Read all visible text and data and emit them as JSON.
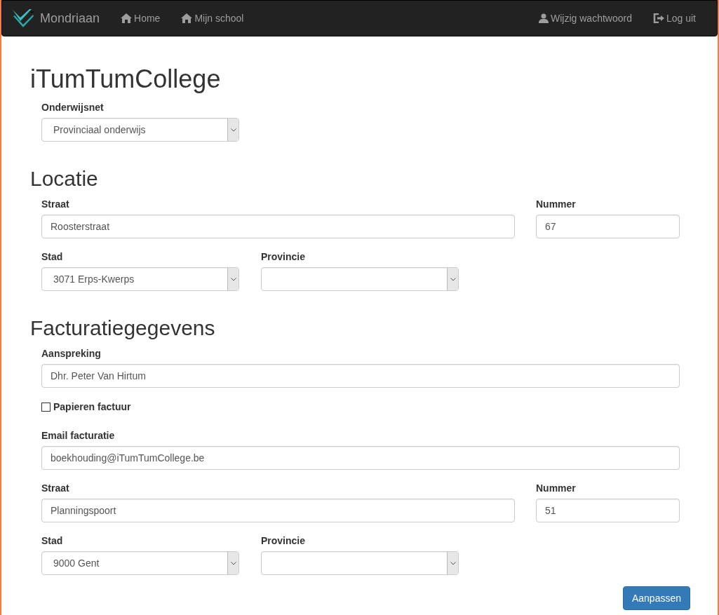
{
  "navbar": {
    "brand": "Mondriaan",
    "left_links": [
      {
        "kind": "home",
        "label": "Home"
      },
      {
        "kind": "home",
        "label": "Mijn school"
      }
    ],
    "right_links": [
      {
        "kind": "account",
        "label": "Wijzig wachtwoord"
      },
      {
        "kind": "exit",
        "label": "Log uit"
      }
    ]
  },
  "title": "iTumTumCollege",
  "onderwijsnet": {
    "label": "Onderwijsnet",
    "value": "Provinciaal onderwijs"
  },
  "locatie": {
    "heading": "Locatie",
    "straat": {
      "label": "Straat",
      "value": "Roosterstraat"
    },
    "nummer": {
      "label": "Nummer",
      "value": "67"
    },
    "stad": {
      "label": "Stad",
      "value": "3071 Erps-Kwerps"
    },
    "provincie": {
      "label": "Provincie"
    }
  },
  "facturatie": {
    "heading": "Facturatiegegevens",
    "aanspreking": {
      "label": "Aanspreking",
      "value": "Dhr. Peter Van Hirtum"
    },
    "papieren_factuur": {
      "label": "Papieren factuur",
      "checked": false
    },
    "email": {
      "label": "Email facturatie",
      "value": "boekhouding@iTumTumCollege.be"
    },
    "straat": {
      "label": "Straat",
      "value": "Planningspoort"
    },
    "nummer": {
      "label": "Nummer",
      "value": "51"
    },
    "stad": {
      "label": "Stad",
      "value": "9000 Gent"
    },
    "provincie": {
      "label": "Provincie"
    }
  },
  "submit": "Aanpassen"
}
